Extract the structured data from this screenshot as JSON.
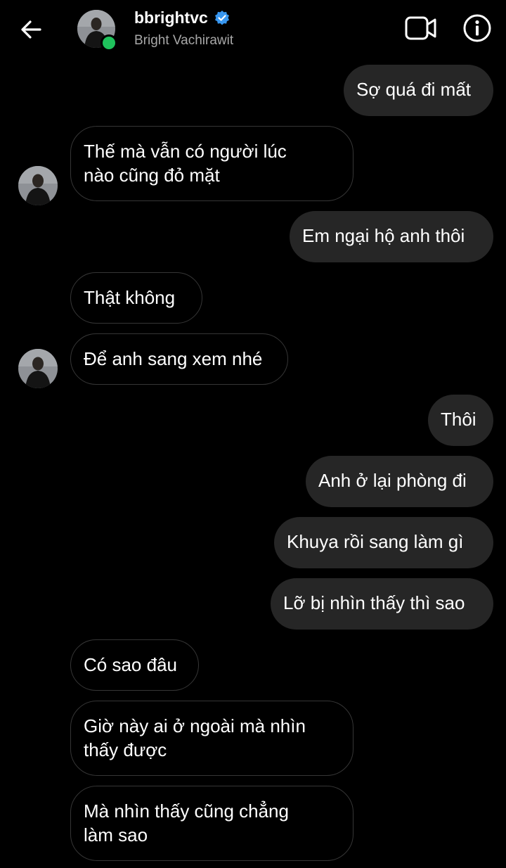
{
  "header": {
    "username": "bbrightvc",
    "full_name": "Bright Vachirawit",
    "verified_icon": "verified-badge-icon",
    "online_color": "#1fc25c"
  },
  "messages": [
    {
      "id": "m1",
      "direction": "outgoing",
      "text": "Sợ quá đi mất"
    },
    {
      "id": "m2",
      "direction": "incoming",
      "text": "Thế mà vẫn có người lúc\nnào cũng đỏ mặt",
      "avatar": true
    },
    {
      "id": "m3",
      "direction": "outgoing",
      "text": "Em ngại hộ anh thôi"
    },
    {
      "id": "m4",
      "direction": "incoming",
      "text": "Thật không"
    },
    {
      "id": "m5",
      "direction": "incoming",
      "text": "Để anh sang xem nhé",
      "avatar": true
    },
    {
      "id": "m6",
      "direction": "outgoing",
      "text": "Thôi"
    },
    {
      "id": "m7",
      "direction": "outgoing",
      "text": "Anh ở lại phòng đi"
    },
    {
      "id": "m8",
      "direction": "outgoing",
      "text": "Khuya rồi sang làm gì"
    },
    {
      "id": "m9",
      "direction": "outgoing",
      "text": "Lỡ bị nhìn thấy thì sao"
    },
    {
      "id": "m10",
      "direction": "incoming",
      "text": "Có sao đâu"
    },
    {
      "id": "m11",
      "direction": "incoming",
      "text": "Giờ này ai ở ngoài mà nhìn\nthấy được"
    },
    {
      "id": "m12",
      "direction": "incoming",
      "text": "Mà nhìn thấy cũng chẳng\nlàm sao"
    }
  ],
  "colors": {
    "background": "#000000",
    "outgoing_bubble": "#262626",
    "incoming_border": "#363636",
    "verified_blue": "#3897f0"
  }
}
